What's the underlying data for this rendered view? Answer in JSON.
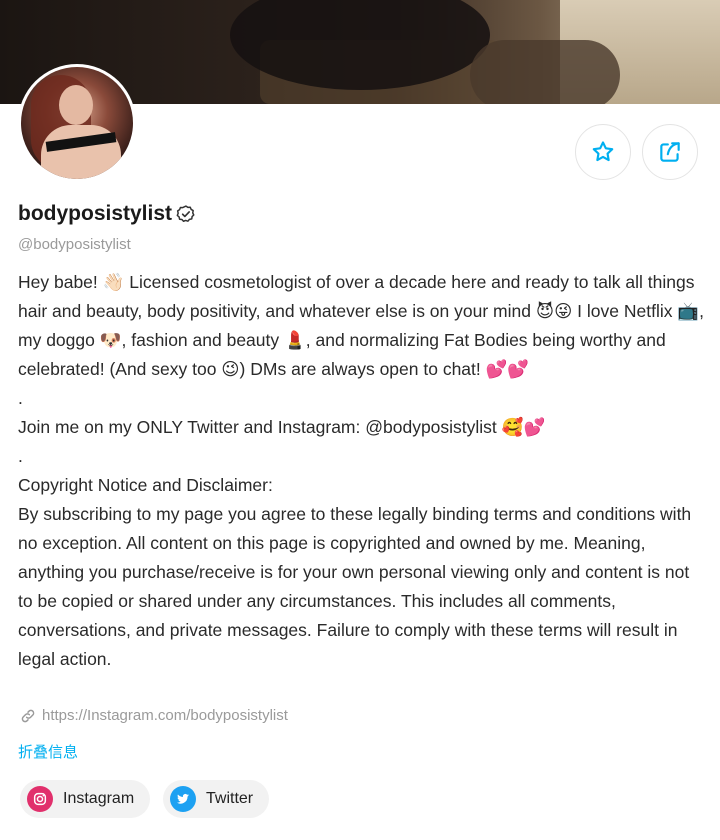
{
  "profile": {
    "display_name": "bodyposistylist",
    "handle": "@bodyposistylist",
    "verified_icon": "verified-check-icon"
  },
  "actions": {
    "favorite_icon": "star-icon",
    "share_icon": "share-icon"
  },
  "bio": {
    "paragraph_1": "Hey babe! 👋🏻 Licensed cosmetologist of over a decade here and ready to talk all things hair and beauty, body positivity, and whatever else is on your mind 😈😜 I love Netflix 📺, my doggo 🐶, fashion and beauty 💄, and normalizing Fat Bodies being worthy and celebrated! (And sexy too 😉) DMs are always open to chat! 💕💕",
    "separator_1": ".",
    "paragraph_2": "Join me on my ONLY Twitter and Instagram: @bodyposistylist 🥰💕",
    "separator_2": ".",
    "paragraph_3": "Copyright Notice and Disclaimer:\nBy subscribing to my page you agree to these legally binding terms and conditions with no exception. All content on this page is copyrighted and owned by me. Meaning, anything you purchase/receive is for your own personal viewing only and content is not to be copied or shared under any circumstances. This includes all comments, conversations, and private messages. Failure to comply with these terms will result in legal action."
  },
  "link": {
    "url": "https://Instagram.com/bodyposistylist",
    "icon": "link-icon"
  },
  "collapse_label": "折叠信息",
  "socials": [
    {
      "label": "Instagram",
      "icon": "instagram-icon",
      "color": "#e1306c"
    },
    {
      "label": "Twitter",
      "icon": "twitter-icon",
      "color": "#1da1f2"
    }
  ],
  "colors": {
    "accent": "#00aff0",
    "muted": "#9a9a9a"
  }
}
